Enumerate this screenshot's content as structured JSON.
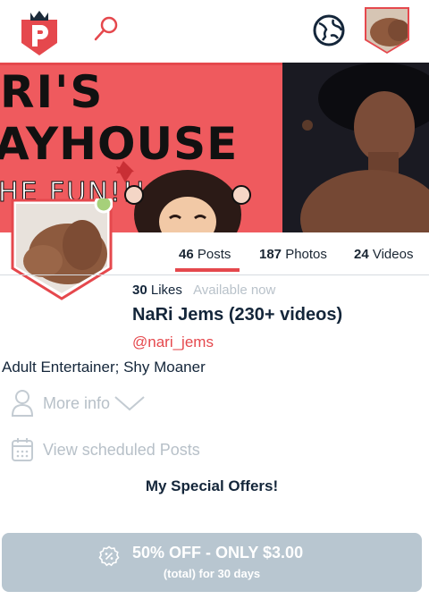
{
  "header": {
    "logo_icon": "p-logo-icon",
    "search_icon": "search-icon",
    "globe_icon": "globe-icon",
    "avatar_icon": "avatar",
    "accent_color": "#e5484d"
  },
  "banner": {
    "line1": "RI'S",
    "line2": "AYHOUSE",
    "line3": "HE FUN!!!"
  },
  "stats": [
    {
      "count": "46",
      "label": "Posts",
      "active": true
    },
    {
      "count": "187",
      "label": "Photos",
      "active": false
    },
    {
      "count": "24",
      "label": "Videos",
      "active": false
    }
  ],
  "profile": {
    "likes_count": "30",
    "likes_label": "Likes",
    "status": "Available now",
    "status_dot_color": "#a6d07a",
    "name": "NaRi Jems (230+ videos)",
    "handle": "@nari_jems",
    "bio": "Adult Entertainer; Shy Moaner"
  },
  "links": {
    "more_info": "More info",
    "scheduled": "View scheduled Posts"
  },
  "offers": {
    "title": "My Special Offers!",
    "main": "50% OFF - ONLY $3.00",
    "sub": "(total) for 30 days",
    "button_color": "#b8c6d0"
  }
}
